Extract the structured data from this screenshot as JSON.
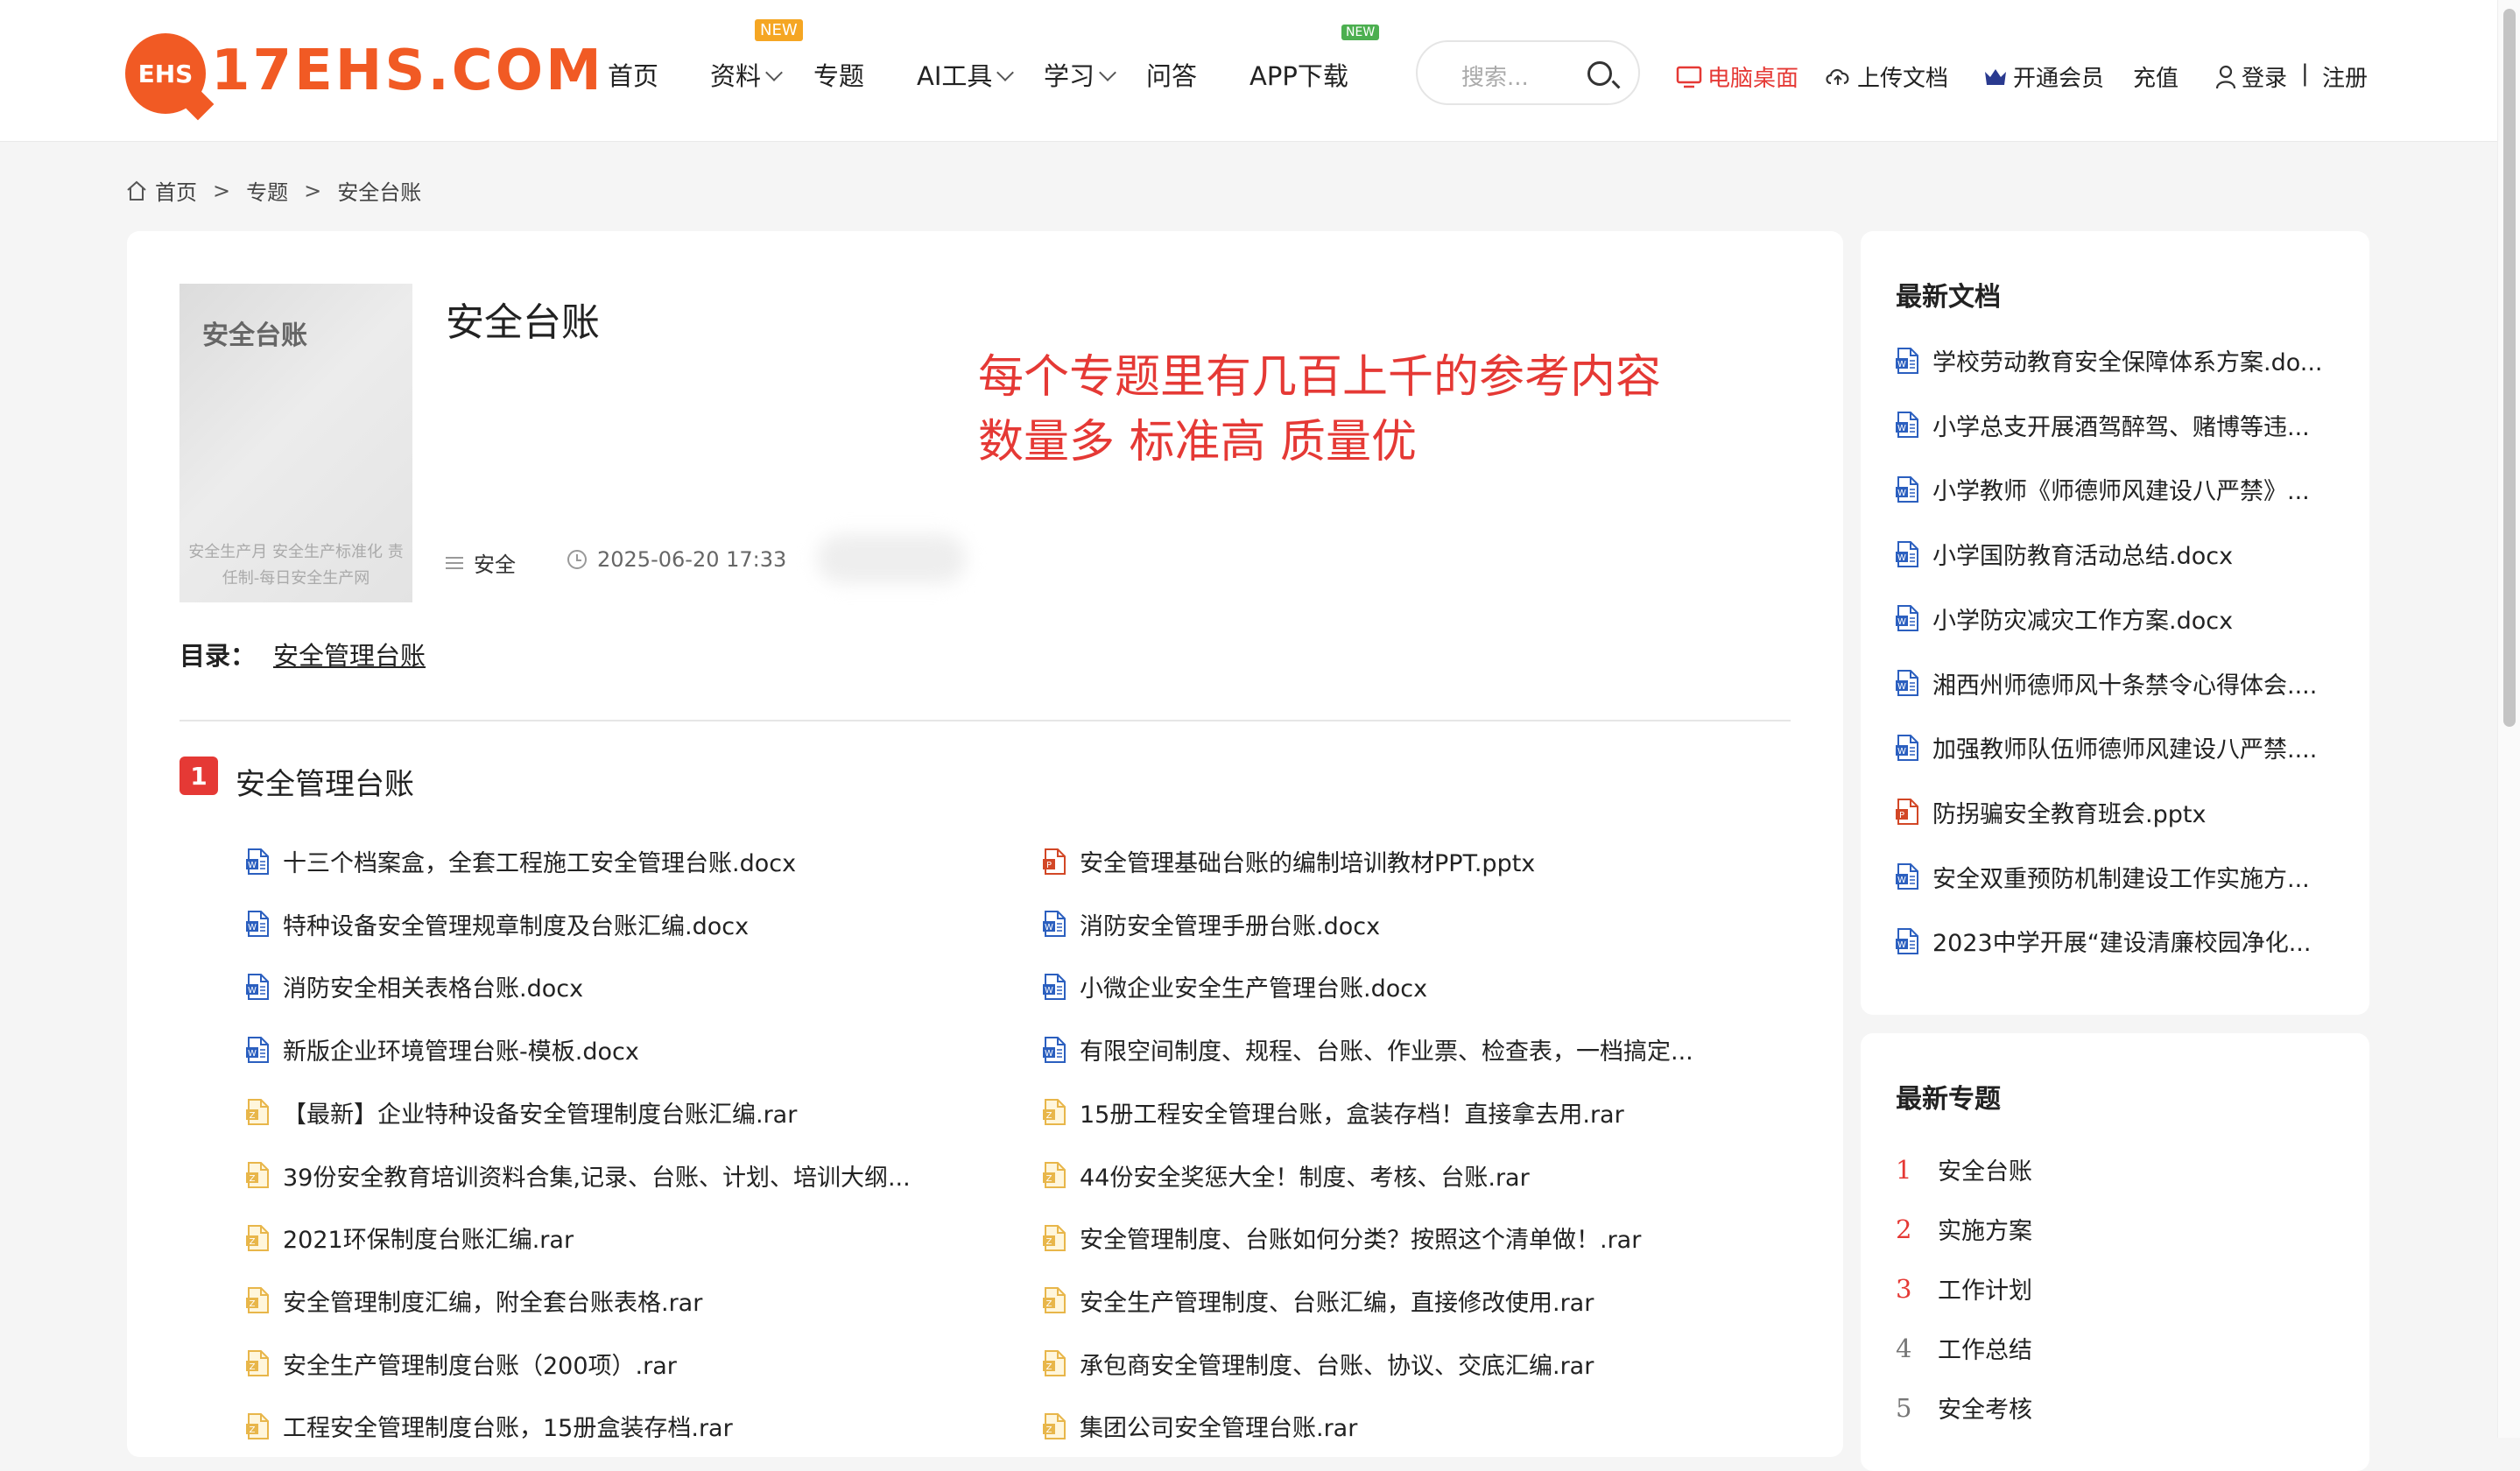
{
  "header": {
    "logo_badge": "EHS",
    "logo_text": "17EHS.COM",
    "nav": [
      {
        "label": "首页",
        "dropdown": false
      },
      {
        "label": "资料",
        "dropdown": true,
        "badge": "NEW"
      },
      {
        "label": "专题",
        "dropdown": false
      },
      {
        "label": "AI工具",
        "dropdown": true
      },
      {
        "label": "学习",
        "dropdown": true
      },
      {
        "label": "问答",
        "dropdown": false
      },
      {
        "label": "APP下载",
        "dropdown": false,
        "badge": "NEW"
      }
    ],
    "search_placeholder": "搜索...",
    "links": {
      "desktop": "电脑桌面",
      "upload": "上传文档",
      "vip": "开通会员",
      "recharge": "充值",
      "login": "登录",
      "separator": "|",
      "register": "注册"
    }
  },
  "breadcrumb": [
    "首页",
    "专题",
    "安全台账"
  ],
  "topic": {
    "cover_title": "安全台账",
    "cover_subtitle": "安全生产月 安全生产标准化 责任制-每日安全生产网",
    "title": "安全台账",
    "promo_line1": "每个专题里有几百上千的参考内容",
    "promo_line2": "数量多 标准高 质量优",
    "category": "安全",
    "datetime": "2025-06-20 17:33",
    "toc_label": "目录：",
    "toc_link": "安全管理台账"
  },
  "section": {
    "number": "1",
    "title": "安全管理台账",
    "files_left": [
      {
        "name": "十三个档案盒，全套工程施工安全管理台账.docx",
        "type": "word"
      },
      {
        "name": "特种设备安全管理规章制度及台账汇编.docx",
        "type": "word"
      },
      {
        "name": "消防安全相关表格台账.docx",
        "type": "word"
      },
      {
        "name": "新版企业环境管理台账-模板.docx",
        "type": "word"
      },
      {
        "name": "【最新】企业特种设备安全管理制度台账汇编.rar",
        "type": "rar"
      },
      {
        "name": "39份安全教育培训资料合集,记录、台账、计划、培训大纲...",
        "type": "rar"
      },
      {
        "name": "2021环保制度台账汇编.rar",
        "type": "rar"
      },
      {
        "name": "安全管理制度汇编，附全套台账表格.rar",
        "type": "rar"
      },
      {
        "name": "安全生产管理制度台账（200项）.rar",
        "type": "rar"
      },
      {
        "name": "工程安全管理制度台账，15册盒装存档.rar",
        "type": "rar"
      }
    ],
    "files_right": [
      {
        "name": "安全管理基础台账的编制培训教材PPT.pptx",
        "type": "ppt"
      },
      {
        "name": "消防安全管理手册台账.docx",
        "type": "word"
      },
      {
        "name": "小微企业安全生产管理台账.docx",
        "type": "word"
      },
      {
        "name": "有限空间制度、规程、台账、作业票、检查表，一档搞定...",
        "type": "word"
      },
      {
        "name": "15册工程安全管理台账，盒装存档！直接拿去用.rar",
        "type": "rar"
      },
      {
        "name": "44份安全奖惩大全！制度、考核、台账.rar",
        "type": "rar"
      },
      {
        "name": "安全管理制度、台账如何分类？按照这个清单做！.rar",
        "type": "rar"
      },
      {
        "name": "安全生产管理制度、台账汇编，直接修改使用.rar",
        "type": "rar"
      },
      {
        "name": "承包商安全管理制度、台账、协议、交底汇编.rar",
        "type": "rar"
      },
      {
        "name": "集团公司安全管理台账.rar",
        "type": "rar"
      }
    ]
  },
  "sidebar": {
    "latest_docs_title": "最新文档",
    "latest_docs": [
      {
        "name": "学校劳动教育安全保障体系方案.do...",
        "type": "word"
      },
      {
        "name": "小学总支开展酒驾醉驾、赌博等违...",
        "type": "word"
      },
      {
        "name": "小学教师《师德师风建设八严禁》...",
        "type": "word"
      },
      {
        "name": "小学国防教育活动总结.docx",
        "type": "word"
      },
      {
        "name": "小学防灾减灾工作方案.docx",
        "type": "word"
      },
      {
        "name": "湘西州师德师风十条禁令心得体会....",
        "type": "word"
      },
      {
        "name": "加强教师队伍师德师风建设八严禁....",
        "type": "word"
      },
      {
        "name": "防拐骗安全教育班会.pptx",
        "type": "ppt"
      },
      {
        "name": "安全双重预防机制建设工作实施方...",
        "type": "word"
      },
      {
        "name": "2023中学开展“建设清廉校园净化...",
        "type": "word"
      }
    ],
    "latest_topics_title": "最新专题",
    "latest_topics": [
      {
        "rank": "1",
        "name": "安全台账"
      },
      {
        "rank": "2",
        "name": "实施方案"
      },
      {
        "rank": "3",
        "name": "工作计划"
      },
      {
        "rank": "4",
        "name": "工作总结"
      },
      {
        "rank": "5",
        "name": "安全考核"
      }
    ]
  },
  "colors": {
    "brand": "#f15a24",
    "accent_red": "#e53935",
    "word_icon": "#2b5fbf",
    "ppt_icon": "#d24726",
    "rar_icon": "#e8b64a"
  }
}
